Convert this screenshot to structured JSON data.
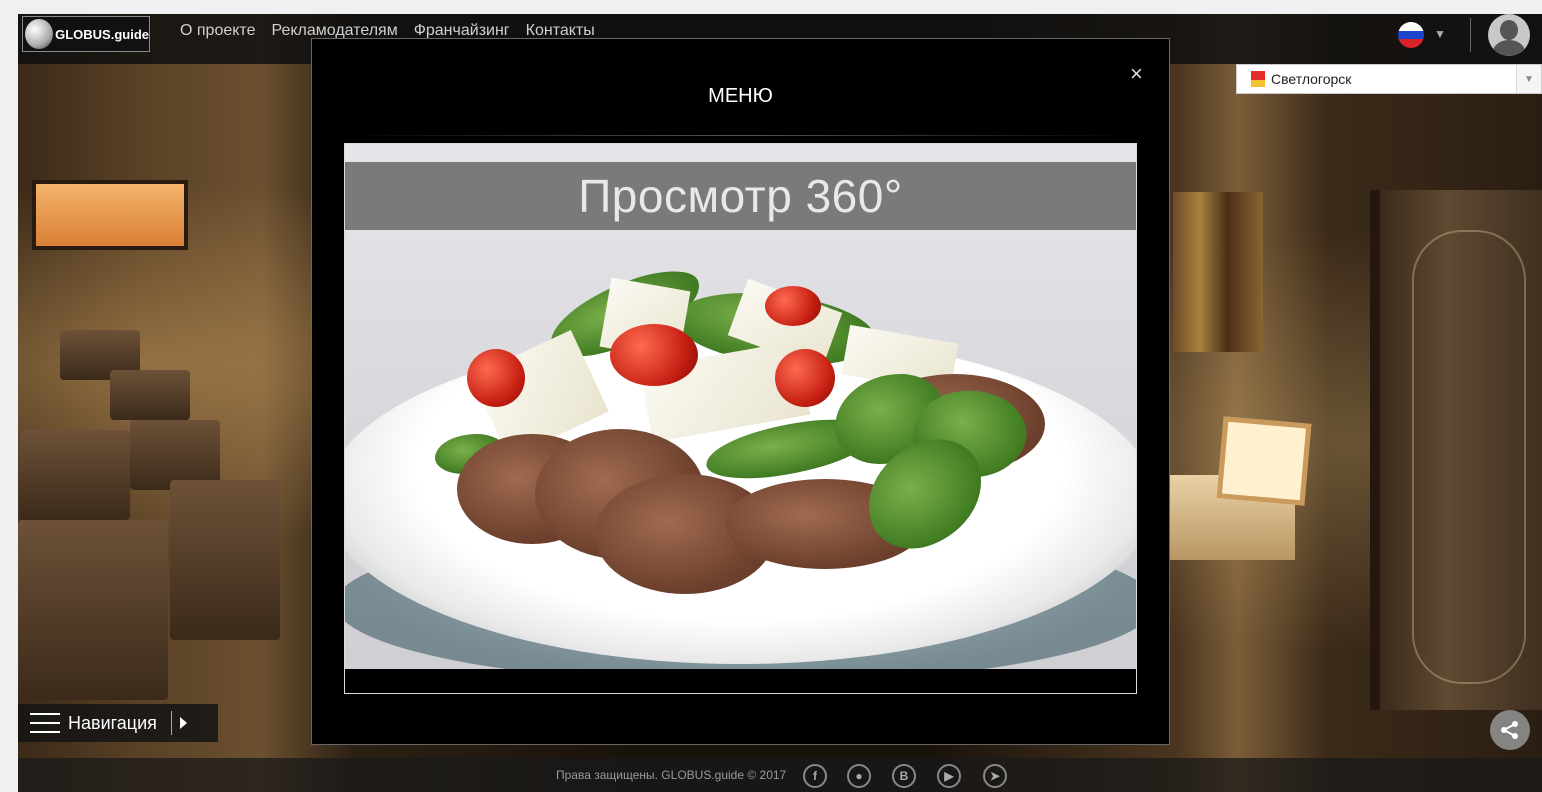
{
  "header": {
    "logo_text": "GLOBUS.guide",
    "nav": [
      "О проекте",
      "Рекламодателям",
      "Франчайзинг",
      "Контакты"
    ]
  },
  "city_select": {
    "value": "Светлогорск"
  },
  "modal": {
    "title": "МЕНЮ",
    "close_label": "×",
    "banner_text": "Просмотр 360°"
  },
  "navigation_button": {
    "label": "Навигация"
  },
  "footer": {
    "copyright": "Права защищены. GLOBUS.guide © 2017",
    "social": [
      "f",
      "vk-icon",
      "B",
      "youtube-icon",
      "telegram-icon"
    ]
  },
  "colors": {
    "topbar_bg": "#0f0f0f",
    "modal_bg": "#000000",
    "banner_bg": "#7a7a7a",
    "flag_white": "#ffffff",
    "flag_blue": "#1c45c9",
    "flag_red": "#d8232a"
  }
}
